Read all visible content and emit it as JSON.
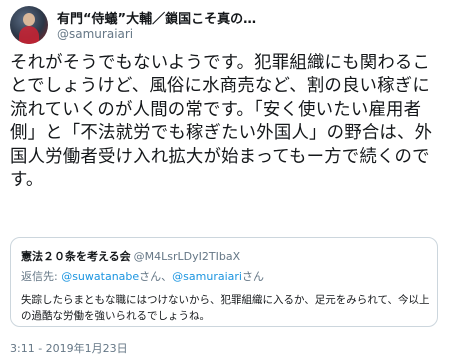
{
  "author": {
    "display_name": "有門“侍蟻”大輔／鎖国こそ真の…",
    "handle": "@samuraiari"
  },
  "tweet": {
    "text": "それがそうでもないようです。犯罪組織にも関わることでしょうけど、風俗に水商売など、割の良い稼ぎに流れていくのが人間の常です。「安く使いたい雇用者側」と「不法就労でも稼ぎたい外国人」の野合は、外国人労働者受け入れ拡大が始まってもー方で続くのです。",
    "timestamp": "3:11 - 2019年1月23日"
  },
  "quoted_tweet": {
    "display_name": "憲法２０条を考える会",
    "handle": "@M4LsrLDyI2TIbaX",
    "reply_prefix": "返信先: ",
    "reply_user1": "@suwatanabe",
    "reply_mid": "さん、",
    "reply_user2": "@samuraiari",
    "reply_suffix": "さん",
    "text": "失踪したらまともな職にはつけないから、犯罪組織に入るか、足元をみられて、今以上の過酷な労働を強いられるでしょうね。"
  }
}
